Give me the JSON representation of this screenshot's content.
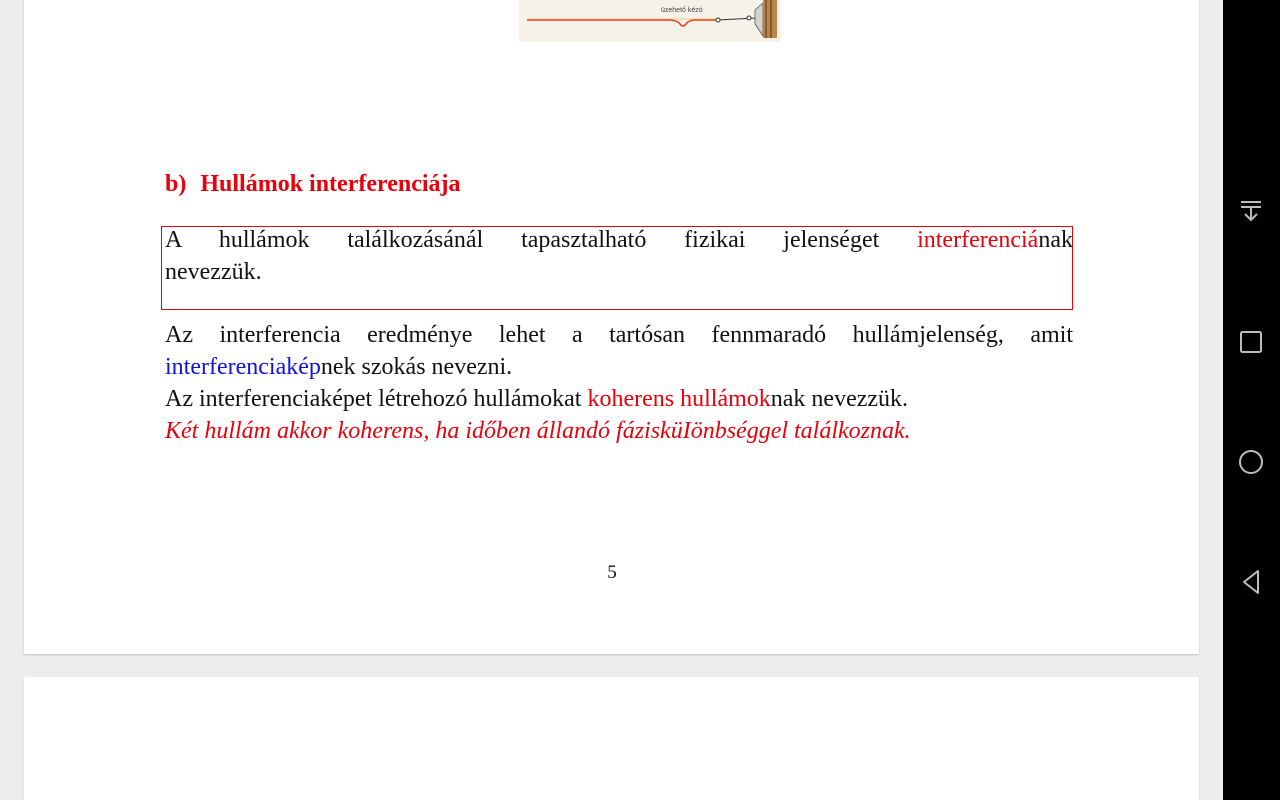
{
  "document": {
    "section_heading": {
      "number": "b)",
      "title": "Hullámok interferenciája"
    },
    "definition": {
      "line1_text": "A hullámok találkozásánál tapasztalható fizikai jelenséget ",
      "line1_term": "interferenciá",
      "line1_suffix": "nak",
      "line2_text": "nevezzük."
    },
    "paragraph": {
      "line1": "Az interferencia eredménye lehet a tartósan fennmaradó hullámjelenség, amit",
      "line2_term": "interferenciakép",
      "line2_suffix": "nek szokás nevezni.",
      "line3_prefix": "Az interferenciaképet létrehozó hullámokat ",
      "line3_term": "koherens hullámok",
      "line3_suffix": "nak nevezzük.",
      "line4_italic": "Két hullám akkor koherens, ha időben állandó fázisküIönbséggel találkoznak."
    },
    "page_number": "5"
  },
  "figure": {
    "caption_fragment": "üzehető kézó"
  },
  "system_nav": {
    "buttons": [
      "notification-collapse-icon",
      "recent-apps-icon",
      "home-icon",
      "back-icon"
    ]
  },
  "colors": {
    "heading_red": "#e8000b",
    "term_blue": "#1010e0",
    "text": "#111111",
    "page_bg": "#ffffff",
    "viewer_bg": "#ededed",
    "navbar_bg": "#000000",
    "nav_icon": "#bdbdbd"
  }
}
